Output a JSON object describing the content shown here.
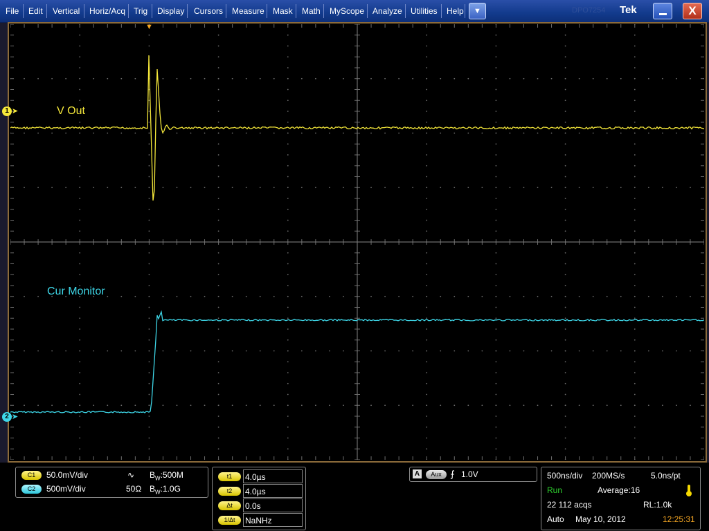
{
  "menu": {
    "items": [
      "File",
      "Edit",
      "Vertical",
      "Horiz/Acq",
      "Trig",
      "Display",
      "Cursors",
      "Measure",
      "Mask",
      "Math",
      "MyScope",
      "Analyze",
      "Utilities",
      "Help"
    ],
    "dropdown_glyph": "▼",
    "brand": "Tek",
    "ghost_text": "DPO7254",
    "minimize_icon": "minimize-icon",
    "close_glyph": "X"
  },
  "display": {
    "trigger_marker_glyph": "▼",
    "ch1_label": "V Out",
    "ch2_label": "Cur Monitor",
    "ch1_marker": "1",
    "ch2_marker": "2",
    "ch1_color": "#f5e83a",
    "ch2_color": "#3ed7e8",
    "grid_color": "#6e6e6e",
    "trigger_color": "#f5a623"
  },
  "channels": {
    "c1": {
      "badge": "C1",
      "scale": "50.0mV/div",
      "coupling_glyph": "∿",
      "bw_prefix": "B",
      "bw_sub": "W",
      "bw_value": ":500M"
    },
    "c2": {
      "badge": "C2",
      "scale": "500mV/div",
      "impedance": "50Ω",
      "bw_prefix": "B",
      "bw_sub": "W",
      "bw_value": ":1.0G"
    }
  },
  "cursors": [
    {
      "label": "t1",
      "value": "4.0µs"
    },
    {
      "label": "t2",
      "value": "4.0µs"
    },
    {
      "label": "Δt",
      "value": "0.0s"
    },
    {
      "label": "1/Δt",
      "value": "NaNHz"
    }
  ],
  "trigger": {
    "source_box": "A",
    "source": "Aux",
    "slope_glyph": "⨍",
    "level": "1.0V"
  },
  "acquisition": {
    "timebase": "500ns/div",
    "sample_rate": "200MS/s",
    "resolution": "5.0ns/pt",
    "state": "Run",
    "mode": "Average:16",
    "acqs": "22 112 acqs",
    "record_length": "RL:1.0k",
    "trigger_mode": "Auto",
    "date": "May 10, 2012",
    "time": "12:25:31",
    "run_color": "#2fd42f",
    "time_color": "#f5a623"
  }
}
